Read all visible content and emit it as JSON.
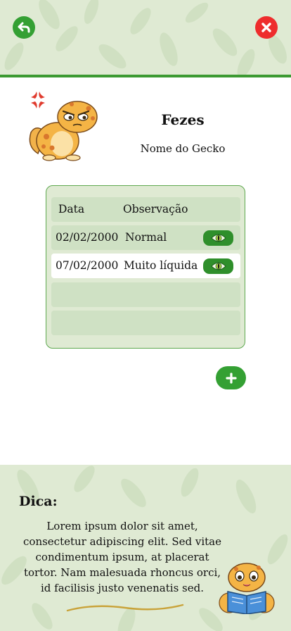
{
  "header": {
    "back_icon": "back-arrow-icon",
    "close_icon": "close-x-icon",
    "accent_color": "#34a033",
    "close_color": "#ee2d2d"
  },
  "page": {
    "title": "Fezes",
    "gecko_name": "Nome do Gecko"
  },
  "table": {
    "columns": [
      "Data",
      "Observação"
    ],
    "rows": [
      {
        "date": "02/02/2000",
        "observation": "Normal",
        "action_icon": "eye-icon"
      },
      {
        "date": "07/02/2000",
        "observation": "Muito líquida",
        "action_icon": "eye-icon"
      }
    ]
  },
  "add_button": {
    "icon": "plus-icon"
  },
  "tip": {
    "title": "Dica:",
    "text": "Lorem ipsum dolor sit amet, consectetur adipiscing elit. Sed vitae condimentum ipsum, at placerat tortor. Nam malesuada rhoncus orci, id facilisis justo venenatis sed."
  }
}
